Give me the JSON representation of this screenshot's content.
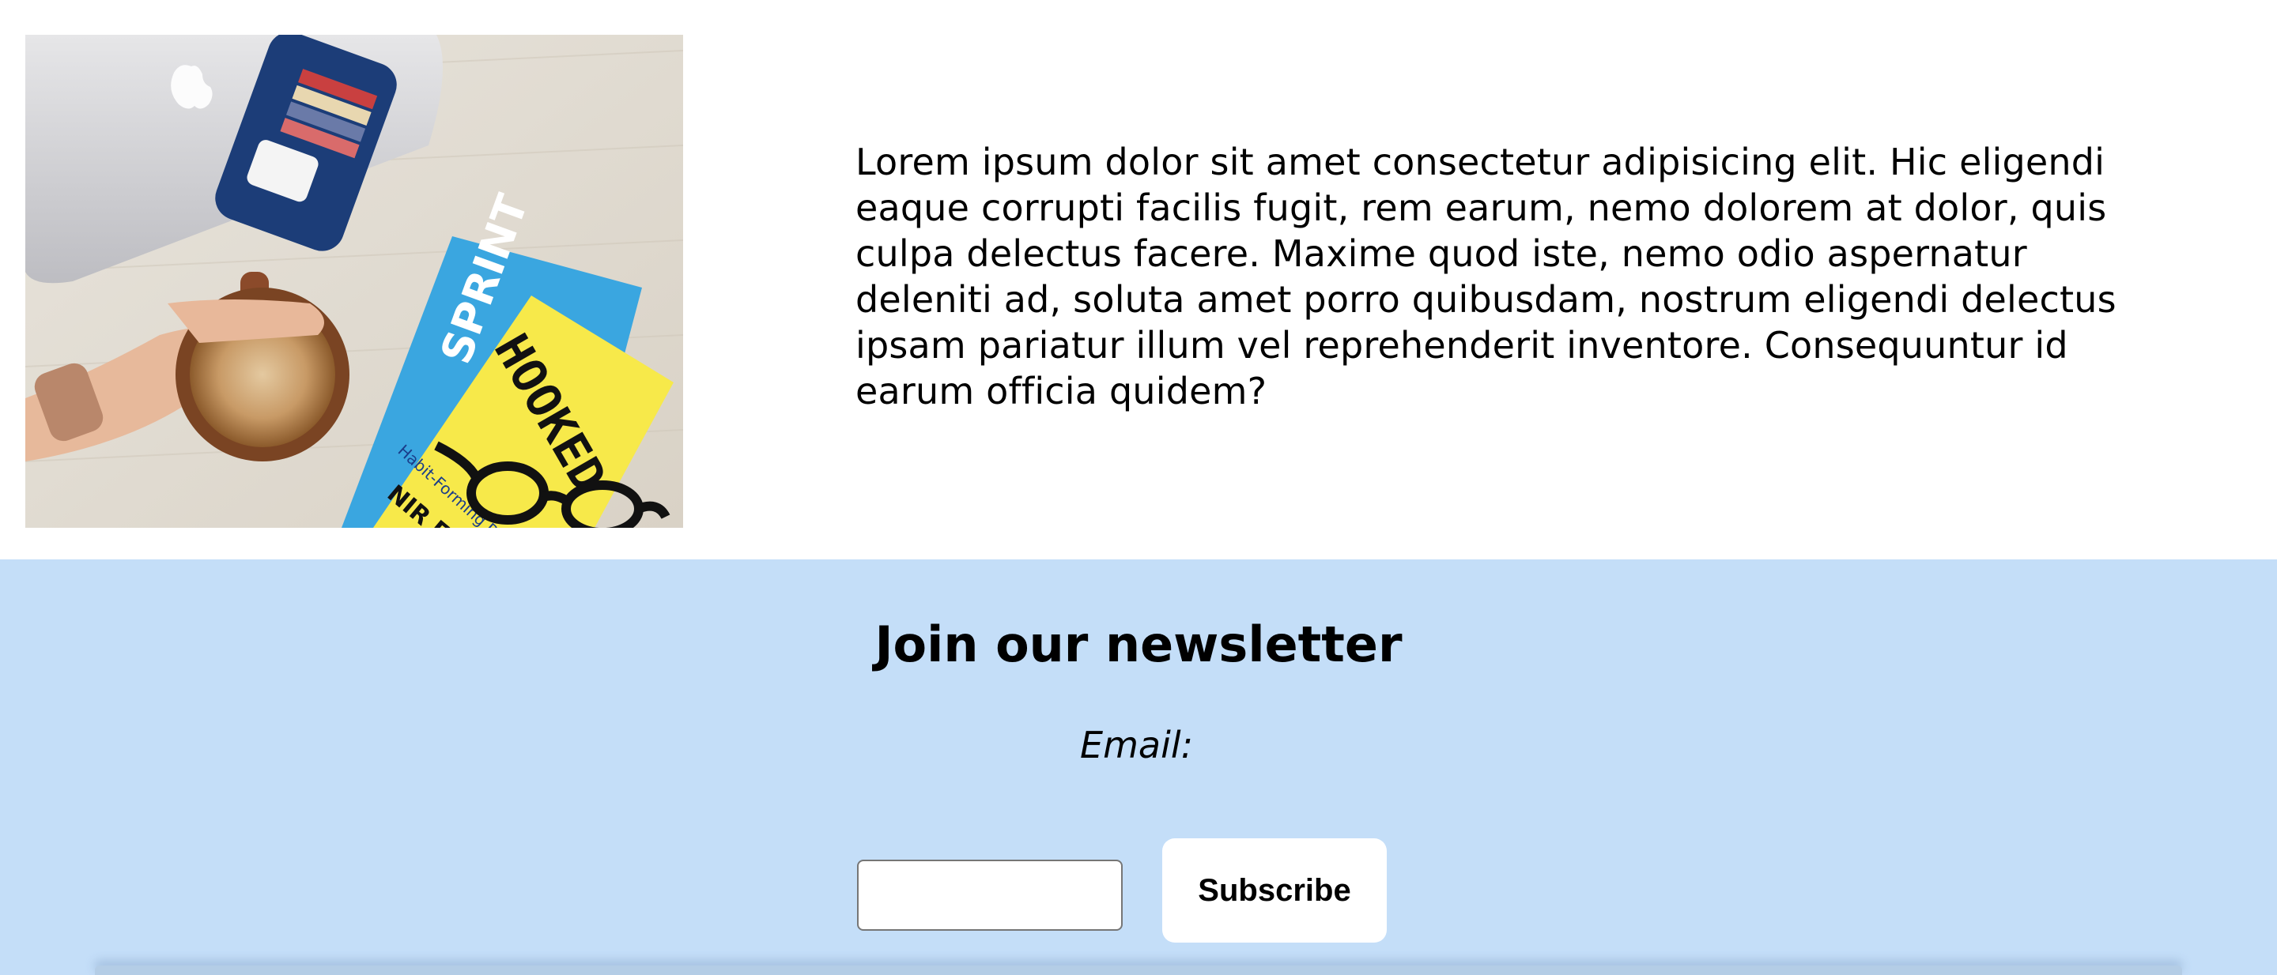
{
  "intro": {
    "text": "Lorem ipsum dolor sit amet consectetur adipisicing elit. Hic eligendi eaque corrupti facilis fugit, rem earum, nemo dolorem at dolor, quis culpa delectus facere. Maxime quod iste, nemo odio aspernatur deleniti ad, soluta amet porro quibusdam, nostrum eligendi delectus ipsam pariatur illum vel reprehenderit inventore. Consequuntur id earum officia quidem?"
  },
  "photo": {
    "book_title": "HOOKED",
    "book_author": "NIR E",
    "book_subtitle": "Habit-Forming Pro",
    "other_book": "SPRINT"
  },
  "newsletter": {
    "title": "Join our newsletter",
    "email_label": "Email:",
    "email_value": "",
    "subscribe_label": "Subscribe"
  },
  "colors": {
    "newsletter_bg": "#c4def8",
    "button_bg": "#ffffff"
  }
}
